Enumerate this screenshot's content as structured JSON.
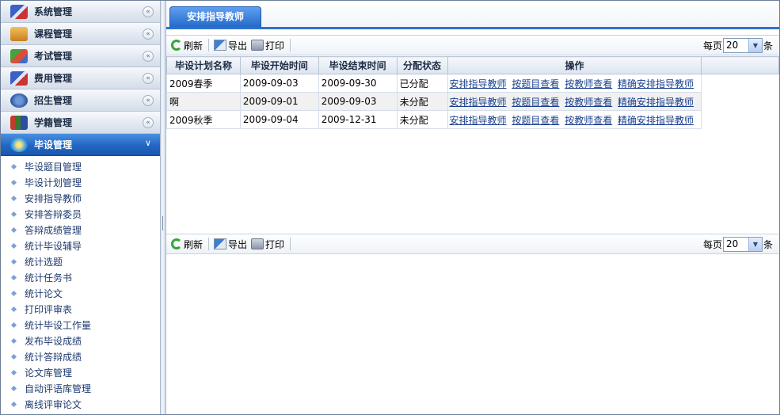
{
  "sidebar": {
    "menus": [
      {
        "label": "系统管理",
        "icon": "system-icon"
      },
      {
        "label": "课程管理",
        "icon": "course-icon"
      },
      {
        "label": "考试管理",
        "icon": "exam-icon"
      },
      {
        "label": "费用管理",
        "icon": "fee-icon"
      },
      {
        "label": "招生管理",
        "icon": "enrollment-icon"
      },
      {
        "label": "学籍管理",
        "icon": "student-record-icon"
      },
      {
        "label": "毕设管理",
        "icon": "graduation-project-icon"
      }
    ],
    "submenu": [
      "毕设题目管理",
      "毕设计划管理",
      "安排指导教师",
      "安排答辩委员",
      "答辩成绩管理",
      "统计毕设辅导",
      "统计选题",
      "统计任务书",
      "统计论文",
      "打印评审表",
      "统计毕设工作量",
      "发布毕设成绩",
      "统计答辩成绩",
      "论文库管理",
      "自动评语库管理",
      "离线评审论文"
    ]
  },
  "tab": {
    "label": "安排指导教师"
  },
  "toolbar": {
    "refresh": "刷新",
    "export": "导出",
    "print": "打印",
    "per_page_prefix": "每页",
    "per_page_value": "20",
    "per_page_suffix": "条"
  },
  "grid": {
    "columns": [
      "毕设计划名称",
      "毕设开始时间",
      "毕设结束时间",
      "分配状态",
      "操作"
    ],
    "rows": [
      {
        "name": "2009春季",
        "start": "2009-09-03",
        "end": "2009-09-30",
        "status": "已分配"
      },
      {
        "name": "啊",
        "start": "2009-09-01",
        "end": "2009-09-03",
        "status": "未分配"
      },
      {
        "name": "2009秋季",
        "start": "2009-09-04",
        "end": "2009-12-31",
        "status": "未分配"
      }
    ],
    "actions": [
      "安排指导教师",
      "按题目查看",
      "按教师查看",
      "精确安排指导教师"
    ]
  },
  "colors": {
    "accent": "#2f71c9",
    "active_menu": "#2266c4",
    "link": "#1a3f8f"
  }
}
